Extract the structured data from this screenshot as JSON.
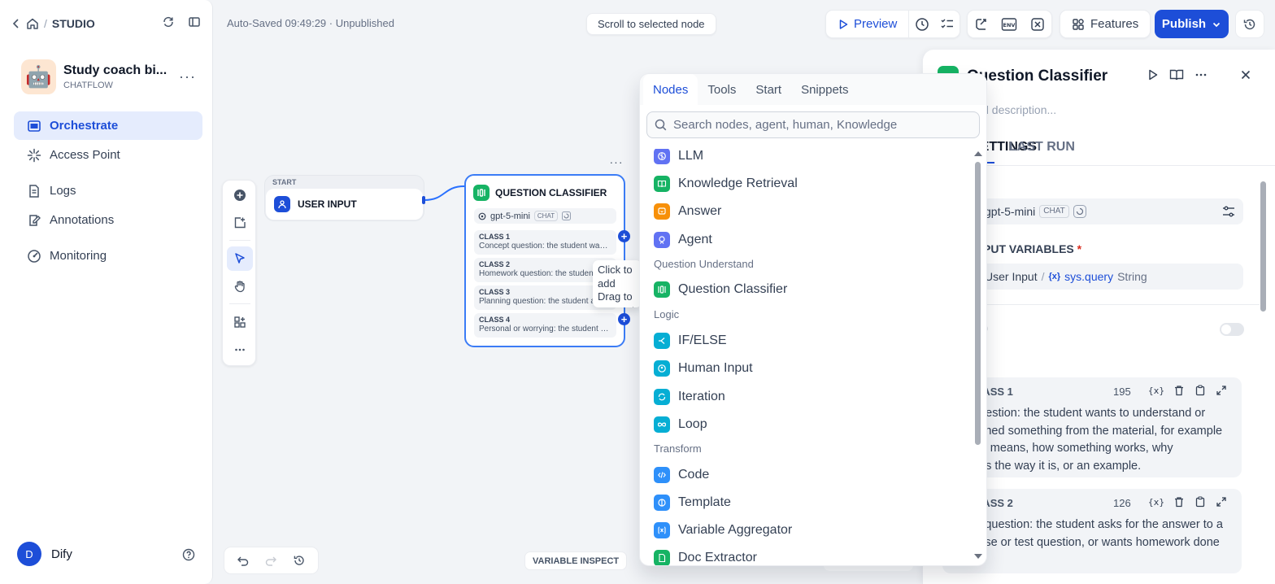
{
  "breadcrumb": {
    "section": "STUDIO",
    "separator": "/"
  },
  "app": {
    "name": "Study coach bi...",
    "kind": "CHATFLOW",
    "avatar_emoji": "🤖"
  },
  "nav": [
    {
      "label": "Orchestrate",
      "active": true
    },
    {
      "label": "Access Point"
    },
    {
      "label": "Logs"
    },
    {
      "label": "Annotations"
    },
    {
      "label": "Monitoring"
    }
  ],
  "user": {
    "initial": "D",
    "name": "Dify"
  },
  "header": {
    "autosaved": "Auto-Saved 09:49:29 · Unpublished",
    "scroll_to_selected": "Scroll to selected node",
    "preview": "Preview",
    "features": "Features",
    "publish": "Publish"
  },
  "canvas": {
    "start_node": {
      "tag": "START",
      "title": "USER INPUT"
    },
    "qc_node": {
      "title": "QUESTION CLASSIFIER",
      "model": "gpt-5-mini",
      "model_tag": "CHAT",
      "classes": [
        {
          "title": "CLASS 1",
          "desc": "Concept question: the student wants to understand"
        },
        {
          "title": "CLASS 2",
          "desc": "Homework question: the student asks for the"
        },
        {
          "title": "CLASS 3",
          "desc": "Planning question: the student asks for"
        },
        {
          "title": "CLASS 4",
          "desc": "Personal or worrying: the student mentions"
        }
      ]
    },
    "tooltip": "Click to add\nDrag to connect",
    "variable_inspect": "VARIABLE INSPECT"
  },
  "picker": {
    "tabs": [
      "Nodes",
      "Tools",
      "Start",
      "Snippets"
    ],
    "active_tab": "Nodes",
    "search_placeholder": "Search nodes, agent, human, Knowledge",
    "items": {
      "llm": "LLM",
      "knowledge": "Knowledge Retrieval",
      "answer": "Answer",
      "agent": "Agent",
      "cat_qu": "Question Understand",
      "qclassifier": "Question Classifier",
      "cat_logic": "Logic",
      "ifelse": "IF/ELSE",
      "human": "Human Input",
      "iteration": "Iteration",
      "loop": "Loop",
      "cat_transform": "Transform",
      "code": "Code",
      "template": "Template",
      "aggregator": "Variable Aggregator",
      "docextractor": "Doc Extractor"
    },
    "colors": {
      "indigo": "#6172f3",
      "green": "#16b364",
      "orange": "#f79009",
      "cyan": "#06aed4",
      "blue": "#2e90fa"
    }
  },
  "panel": {
    "title": "Question Classifier",
    "desc_placeholder": "Add description...",
    "tabs": [
      "SETTINGS",
      "LAST RUN"
    ],
    "model": "gpt-5-mini",
    "model_tag": "CHAT",
    "input_var_label": "INPUT VARIABLES",
    "input_var_required": "*",
    "var_node": "User Input",
    "var_sep": "/",
    "var_icon": "{x}",
    "var_name": "sys.query",
    "var_type": "String",
    "classes": [
      {
        "label": "CLASS 1",
        "count": "195",
        "text": "Concept question: the student wants to understand or have explained something from the material, for example what a term means, how something works, why something is the way it is, or an example."
      },
      {
        "label": "CLASS 2",
        "count": "126",
        "text": "Homework question: the student asks for the answer to a task, exercise or test question, or wants homework done or marked."
      }
    ]
  }
}
